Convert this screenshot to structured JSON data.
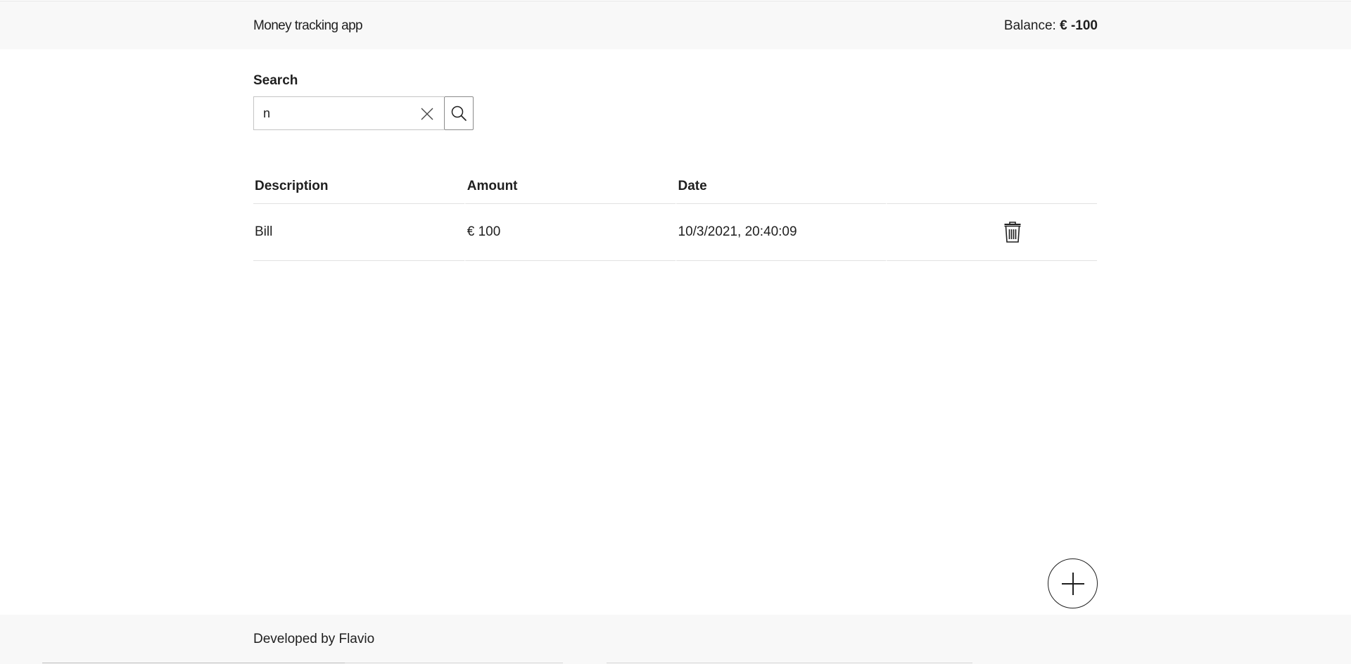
{
  "header": {
    "app_title": "Money tracking app",
    "balance_label": "Balance:",
    "balance_value": "€ -100"
  },
  "search": {
    "label": "Search",
    "value": "n",
    "placeholder": ""
  },
  "table": {
    "headers": [
      "Description",
      "Amount",
      "Date",
      ""
    ],
    "rows": [
      {
        "description": "Bill",
        "amount": "€ 100",
        "date": "10/3/2021, 20:40:09"
      }
    ]
  },
  "footer": {
    "text": "Developed by Flavio"
  },
  "icons": {
    "clear": "close-icon",
    "search": "search-icon",
    "delete": "trash-icon",
    "add": "plus-icon"
  },
  "colors": {
    "negative_amount": "#e8130f",
    "header_bg": "#f8f8f8"
  }
}
